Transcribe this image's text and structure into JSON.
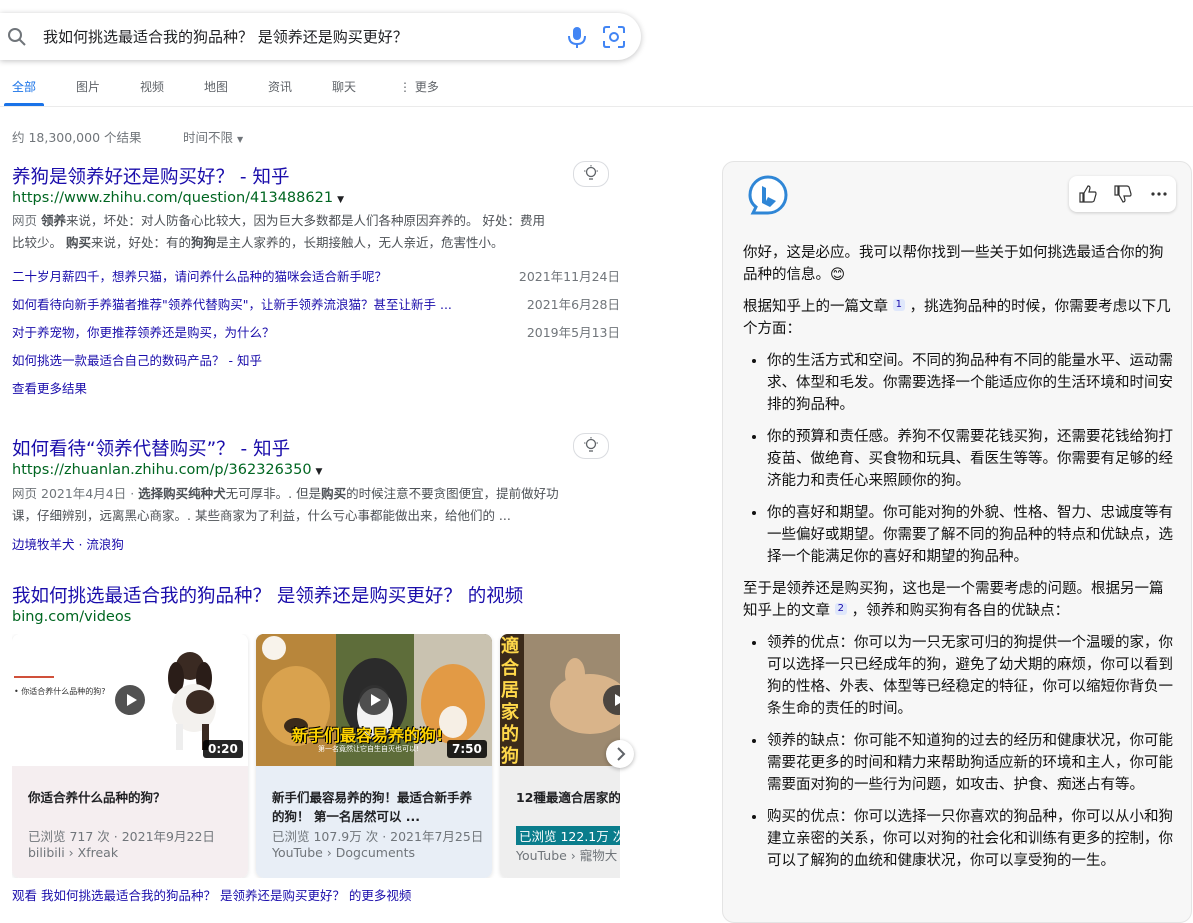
{
  "search": {
    "query": "我如何挑选最适合我的狗品种？ 是领养还是购买更好？"
  },
  "tabs": [
    {
      "label": "全部"
    },
    {
      "label": "图片"
    },
    {
      "label": "视频"
    },
    {
      "label": "地图"
    },
    {
      "label": "资讯"
    },
    {
      "label": "聊天"
    },
    {
      "label": "⋮ 更多"
    }
  ],
  "results_count": "约 18,300,000 个结果",
  "time_filter": "时间不限",
  "results": [
    {
      "title": "养狗是领养好还是购买好？ - 知乎",
      "url": "https://www.zhihu.com/question/413488621",
      "tag": "网页",
      "snippet_lines": [
        {
          "b1": "领养",
          "t1": "来说，坏处：对人防备心比较大，因为巨大多数都是人们各种原因弃养的。 好处：费用"
        },
        {
          "b1": "",
          "t1": "比较少。 ",
          "b2": "购买",
          "t2": "来说，好处：有的",
          "b3": "狗狗",
          "t3": "是主人家养的，长期接触人，无人亲近，危害性小。"
        }
      ],
      "sublinks": [
        {
          "text": "二十岁月薪四千，想养只猫，请问养什么品种的猫咪会适合新手呢？",
          "date": "2021年11月24日"
        },
        {
          "text": "如何看待向新手养猫者推荐\"领养代替购买\"，让新手领养流浪猫？甚至让新手 ...",
          "date": "2021年6月28日"
        },
        {
          "text": "对于养宠物，你更推荐领养还是购买，为什么？",
          "date": "2019年5月13日"
        },
        {
          "text": "如何挑选一款最适合自己的数码产品？ - 知乎",
          "date": ""
        }
      ],
      "more": "查看更多结果"
    },
    {
      "title": "如何看待“领养代替购买”？ - 知乎",
      "url": "https://zhuanlan.zhihu.com/p/362326350",
      "tag": "网页",
      "date": "2021年4月4日 · ",
      "b1": "选择购买纯种犬",
      "t1": "无可厚非。. 但是",
      "b2": "购买",
      "t2": "的时候注意不要贪图便宜，提前做好功",
      "line2": "课，仔细辨别，远离黑心商家。. 某些商家为了利益，什么亏心事都能做出来，给他们的 ...",
      "related": "边境牧羊犬 · 流浪狗"
    }
  ],
  "videos": {
    "title": "我如何挑选最适合我的狗品种？ 是领养还是购买更好？ 的视频",
    "source": "bing.com/videos",
    "items": [
      {
        "name": "你适合养什么品种的狗？",
        "meta": "已浏览 717 次 · 2021年9月22日",
        "src": "bilibili › Xfreak",
        "duration": "0:20",
        "thumb_text": "• 你适合养什么品种的狗?"
      },
      {
        "name": "新手们最容易养的狗！最适合新手养的狗！ 第一名居然可以 ...",
        "meta": "已浏览 107.9万 次 · 2021年7月25日",
        "src": "YouTube › Dogcuments",
        "duration": "7:50",
        "thumb_text": "新手们最容易养的狗!",
        "thumb_sub": "第一名竟然让它自生自灭也可以!"
      },
      {
        "name": "12種最適合居家的",
        "meta": "已浏览 122.1万 次",
        "src": "YouTube › 寵物大",
        "thumb_text": "適合居家的狗"
      }
    ],
    "more": "观看 我如何挑选最适合我的狗品种？ 是领养还是购买更好？ 的更多视频"
  },
  "chat": {
    "greeting": "你好，这是必应。我可以帮你找到一些关于如何挑选最适合你的狗品种的信息。😊",
    "intro1": "根据知乎上的一篇文章",
    "cite1": "1",
    "intro2": "，挑选狗品种的时候，你需要考虑以下几个方面：",
    "points1": [
      "你的生活方式和空间。不同的狗品种有不同的能量水平、运动需求、体型和毛发。你需要选择一个能适应你的生活环境和时间安排的狗品种。",
      "你的预算和责任感。养狗不仅需要花钱买狗，还需要花钱给狗打疫苗、做绝育、买食物和玩具、看医生等等。你需要有足够的经济能力和责任心来照顾你的狗。",
      "你的喜好和期望。你可能对狗的外貌、性格、智力、忠诚度等有一些偏好或期望。你需要了解不同的狗品种的特点和优缺点，选择一个能满足你的喜好和期望的狗品种。"
    ],
    "para2a": "至于是领养还是购买狗，这也是一个需要考虑的问题。根据另一篇知乎上的文章",
    "cite2": "2",
    "para2b": "，领养和购买狗有各自的优缺点：",
    "points2": [
      "领养的优点：你可以为一只无家可归的狗提供一个温暖的家，你可以选择一只已经成年的狗，避免了幼犬期的麻烦，你可以看到狗的性格、外表、体型等已经稳定的特征，你可以缩短你背负一条生命的责任的时间。",
      "领养的缺点：你可能不知道狗的过去的经历和健康状况，你可能需要花更多的时间和精力来帮助狗适应新的环境和主人，你可能需要面对狗的一些行为问题，如攻击、护食、痴迷占有等。",
      "购买的优点：你可以选择一只你喜欢的狗品种，你可以从小和狗建立亲密的关系，你可以对狗的社会化和训练有更多的控制，你可以了解狗的血统和健康状况，你可以享受狗的一生。"
    ]
  },
  "colors": {
    "link": "#1a0dab",
    "url": "#006621",
    "accent": "#1a73e8"
  }
}
